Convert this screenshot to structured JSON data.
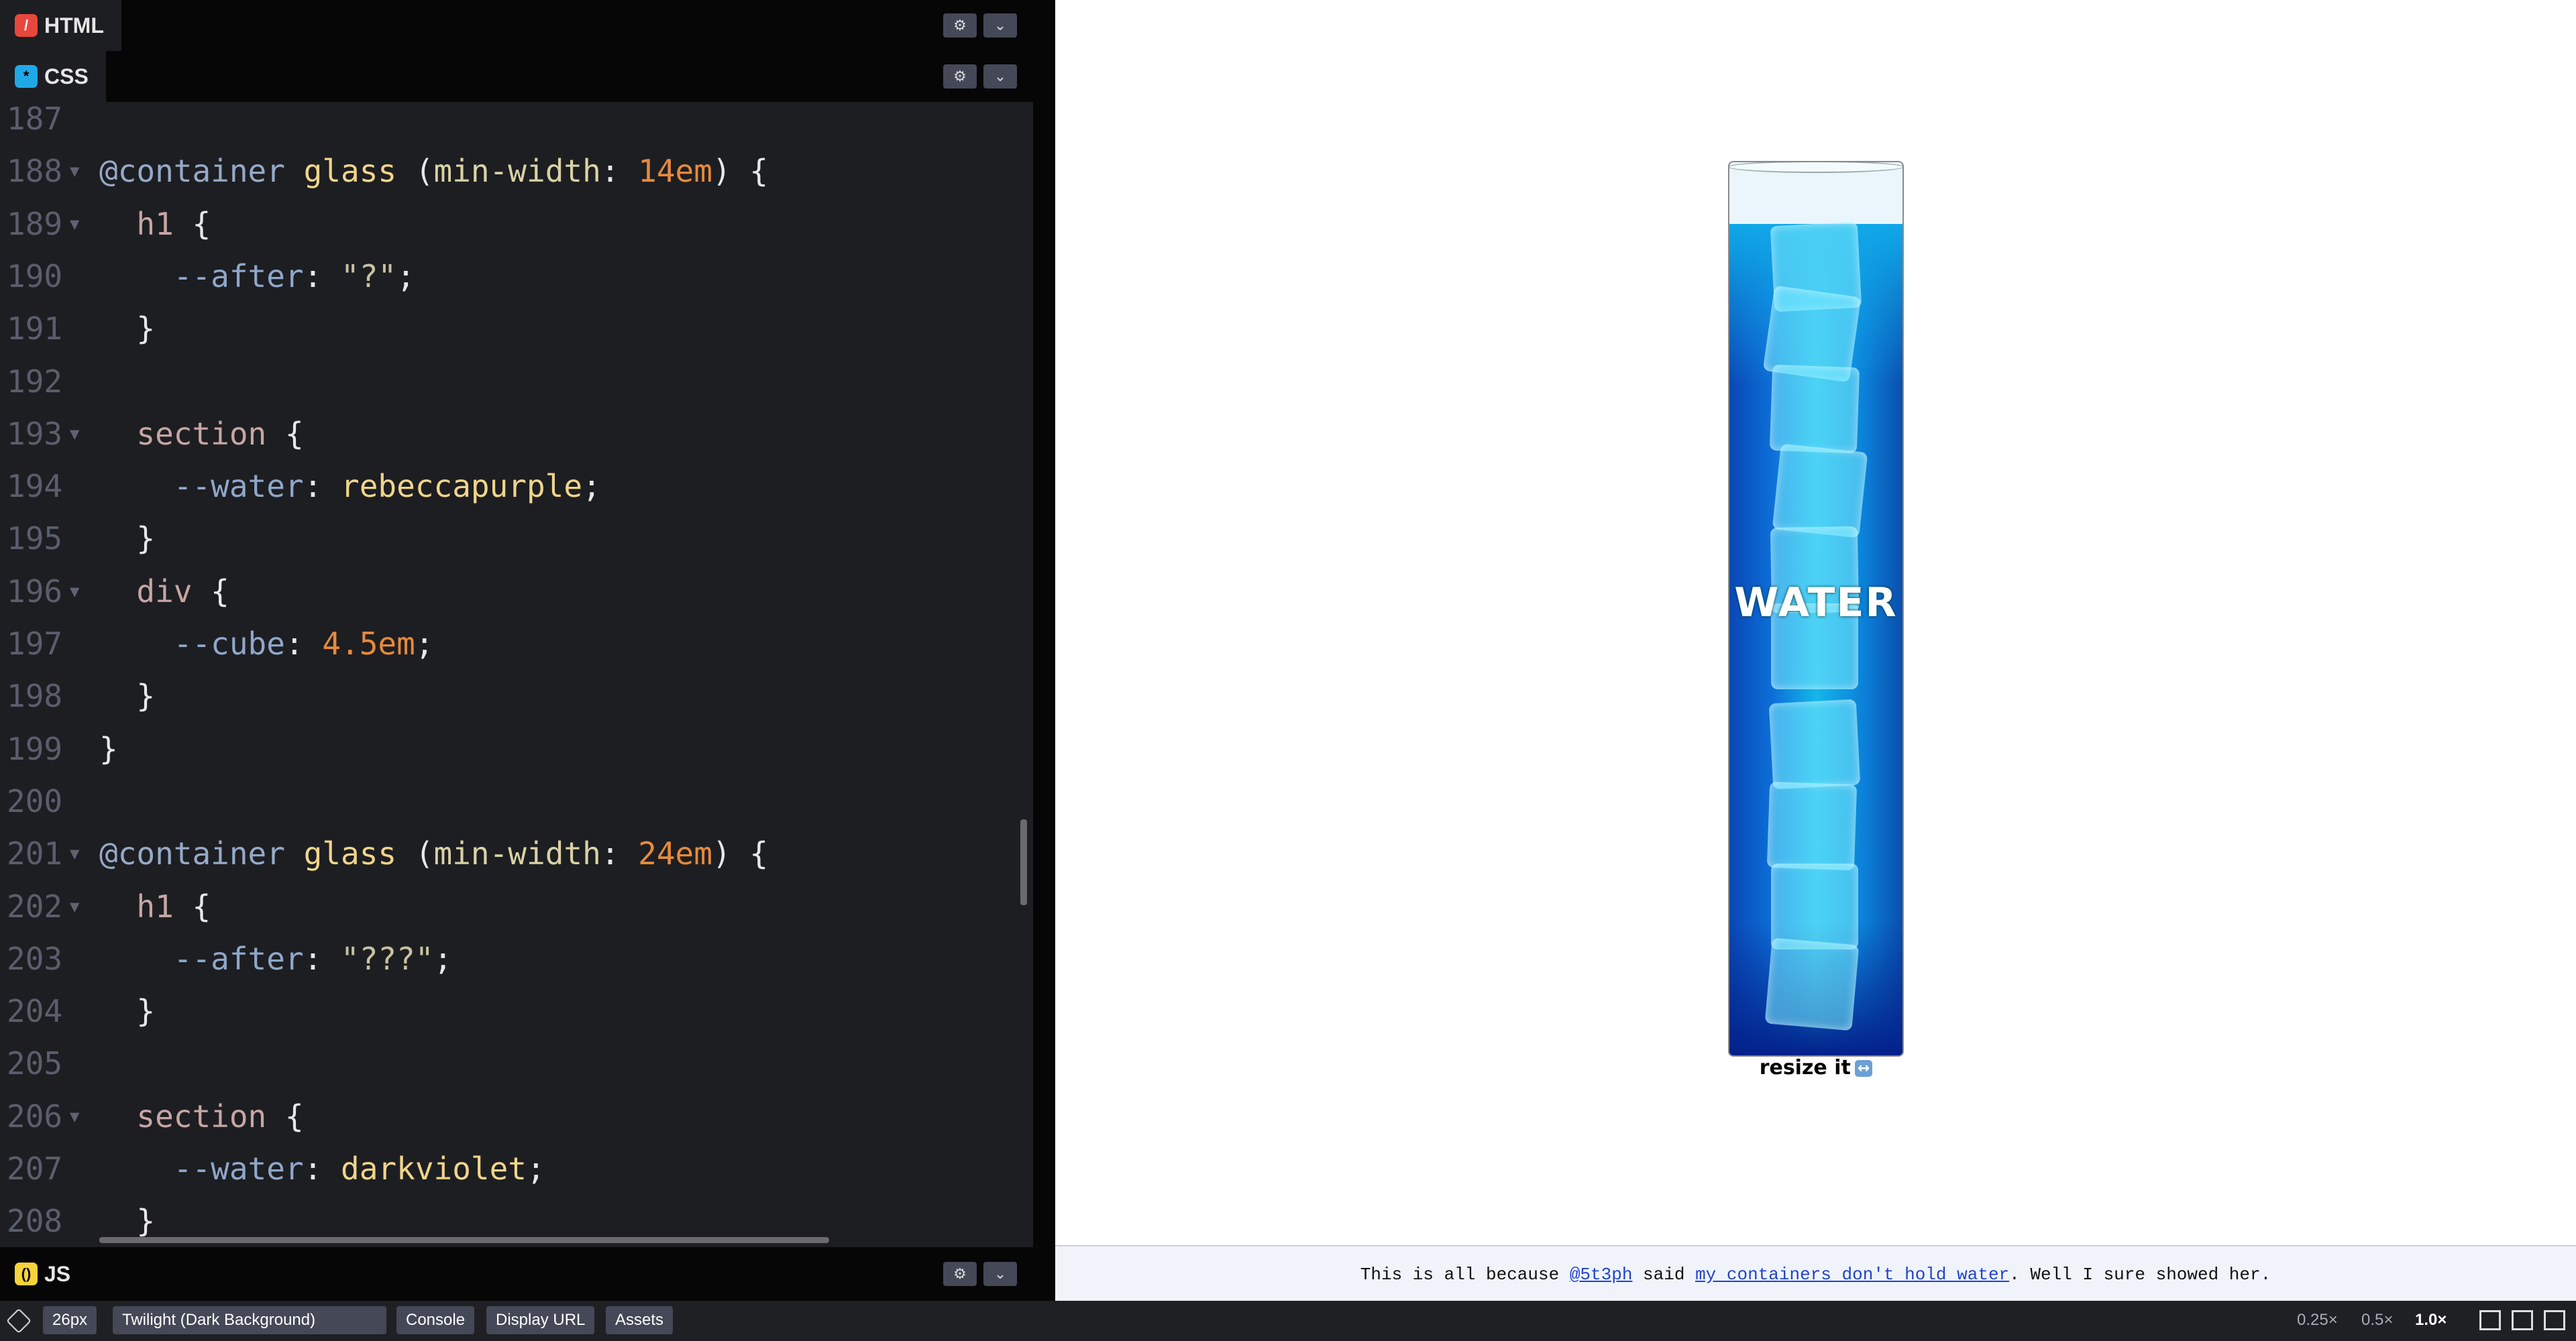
{
  "editor": {
    "html_tab": "HTML",
    "css_tab": "CSS",
    "js_tab": "JS",
    "settings_icon": "gear-icon",
    "collapse_icon": "chevron-down-icon",
    "lines": [
      {
        "n": "187",
        "fold": false,
        "tokens": []
      },
      {
        "n": "188",
        "fold": true,
        "tokens": [
          [
            "t-at",
            "@container"
          ],
          [
            "t-p",
            " "
          ],
          [
            "t-name",
            "glass"
          ],
          [
            "t-p",
            " ("
          ],
          [
            "t-prop",
            "min-width"
          ],
          [
            "t-p",
            ": "
          ],
          [
            "t-num",
            "14em"
          ],
          [
            "t-p",
            ") {"
          ]
        ]
      },
      {
        "n": "189",
        "fold": true,
        "tokens": [
          [
            "t-p",
            "  "
          ],
          [
            "t-sel",
            "h1"
          ],
          [
            "t-p",
            " {"
          ]
        ]
      },
      {
        "n": "190",
        "fold": false,
        "tokens": [
          [
            "t-p",
            "    "
          ],
          [
            "t-var",
            "--after"
          ],
          [
            "t-p",
            ": "
          ],
          [
            "t-str",
            "\"?\""
          ],
          [
            "t-p",
            ";"
          ]
        ]
      },
      {
        "n": "191",
        "fold": false,
        "tokens": [
          [
            "t-p",
            "  }"
          ]
        ]
      },
      {
        "n": "192",
        "fold": false,
        "tokens": []
      },
      {
        "n": "193",
        "fold": true,
        "tokens": [
          [
            "t-p",
            "  "
          ],
          [
            "t-sel",
            "section"
          ],
          [
            "t-p",
            " {"
          ]
        ]
      },
      {
        "n": "194",
        "fold": false,
        "tokens": [
          [
            "t-p",
            "    "
          ],
          [
            "t-var",
            "--water"
          ],
          [
            "t-p",
            ": "
          ],
          [
            "t-val",
            "rebeccapurple"
          ],
          [
            "t-p",
            ";"
          ]
        ]
      },
      {
        "n": "195",
        "fold": false,
        "tokens": [
          [
            "t-p",
            "  }"
          ]
        ]
      },
      {
        "n": "196",
        "fold": true,
        "tokens": [
          [
            "t-p",
            "  "
          ],
          [
            "t-sel",
            "div"
          ],
          [
            "t-p",
            " {"
          ]
        ]
      },
      {
        "n": "197",
        "fold": false,
        "tokens": [
          [
            "t-p",
            "    "
          ],
          [
            "t-var",
            "--cube"
          ],
          [
            "t-p",
            ": "
          ],
          [
            "t-num",
            "4.5em"
          ],
          [
            "t-p",
            ";"
          ]
        ]
      },
      {
        "n": "198",
        "fold": false,
        "tokens": [
          [
            "t-p",
            "  }"
          ]
        ]
      },
      {
        "n": "199",
        "fold": false,
        "tokens": [
          [
            "t-p",
            "}"
          ]
        ]
      },
      {
        "n": "200",
        "fold": false,
        "tokens": []
      },
      {
        "n": "201",
        "fold": true,
        "tokens": [
          [
            "t-at",
            "@container"
          ],
          [
            "t-p",
            " "
          ],
          [
            "t-name",
            "glass"
          ],
          [
            "t-p",
            " ("
          ],
          [
            "t-prop",
            "min-width"
          ],
          [
            "t-p",
            ": "
          ],
          [
            "t-num",
            "24em"
          ],
          [
            "t-p",
            ") {"
          ]
        ]
      },
      {
        "n": "202",
        "fold": true,
        "tokens": [
          [
            "t-p",
            "  "
          ],
          [
            "t-sel",
            "h1"
          ],
          [
            "t-p",
            " {"
          ]
        ]
      },
      {
        "n": "203",
        "fold": false,
        "tokens": [
          [
            "t-p",
            "    "
          ],
          [
            "t-var",
            "--after"
          ],
          [
            "t-p",
            ": "
          ],
          [
            "t-str",
            "\"???\""
          ],
          [
            "t-p",
            ";"
          ]
        ]
      },
      {
        "n": "204",
        "fold": false,
        "tokens": [
          [
            "t-p",
            "  }"
          ]
        ]
      },
      {
        "n": "205",
        "fold": false,
        "tokens": []
      },
      {
        "n": "206",
        "fold": true,
        "tokens": [
          [
            "t-p",
            "  "
          ],
          [
            "t-sel",
            "section"
          ],
          [
            "t-p",
            " {"
          ]
        ]
      },
      {
        "n": "207",
        "fold": false,
        "tokens": [
          [
            "t-p",
            "    "
          ],
          [
            "t-var",
            "--water"
          ],
          [
            "t-p",
            ": "
          ],
          [
            "t-val",
            "darkviolet"
          ],
          [
            "t-p",
            ";"
          ]
        ]
      },
      {
        "n": "208",
        "fold": false,
        "tokens": [
          [
            "t-p",
            "  }"
          ]
        ]
      }
    ]
  },
  "preview": {
    "water_label": "WATER",
    "resize_label": "resize it",
    "resize_icon": "↔",
    "footer": {
      "prefix": "This is all because ",
      "user_link": "@5t3ph",
      "middle": " said ",
      "quote_link": "my containers don't hold water",
      "suffix": ". Well I sure showed her."
    }
  },
  "bottom_bar": {
    "font_size": "26px",
    "theme": "Twilight (Dark Background)",
    "console": "Console",
    "display_url": "Display URL",
    "assets": "Assets",
    "zoom_options": [
      "0.25×",
      "0.5×",
      "1.0×"
    ],
    "zoom_selected": "1.0×"
  },
  "colors": {
    "editor_bg": "#1d1e22",
    "html_icon": "#e8473c",
    "css_icon": "#1fa8e8",
    "js_icon": "#f7d23a"
  }
}
